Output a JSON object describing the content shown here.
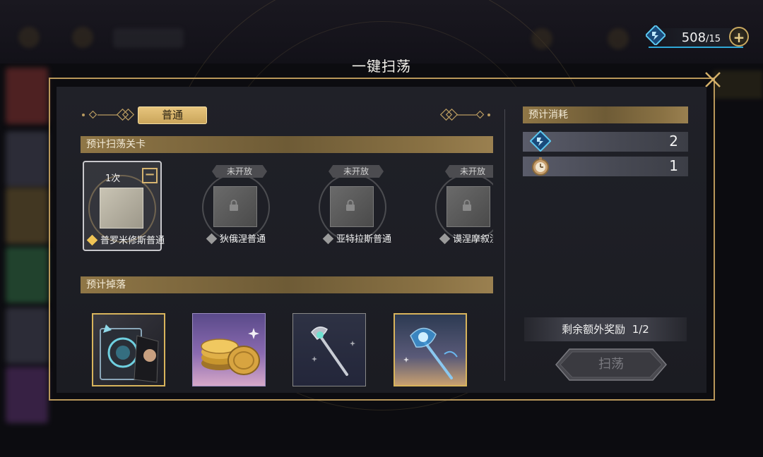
{
  "currency": {
    "amount": "508",
    "max": "/15",
    "icon": "energy-icon",
    "add_icon": "plus-icon"
  },
  "modal": {
    "title": "一键扫荡",
    "close_icon": "close-icon"
  },
  "difficulty": {
    "selected": "普通"
  },
  "stages_header": "预计扫荡关卡",
  "stages": [
    {
      "name": "普罗米修斯普通",
      "count": "1次",
      "locked": false,
      "selected": true
    },
    {
      "name": "狄俄涅普通",
      "status": "未开放",
      "locked": true
    },
    {
      "name": "亚特拉斯普通",
      "status": "未开放",
      "locked": true
    },
    {
      "name": "谟涅摩叙涅",
      "status": "未开放",
      "locked": true
    }
  ],
  "drops_header": "预计掉落",
  "drops": [
    {
      "icon": "tarot-card-icon",
      "rarity": "gold"
    },
    {
      "icon": "gold-coins-icon",
      "rarity": "purple"
    },
    {
      "icon": "silver-staff-icon",
      "rarity": "silver"
    },
    {
      "icon": "crystal-wand-icon",
      "rarity": "gold"
    }
  ],
  "cost": {
    "header": "预计消耗",
    "items": [
      {
        "icon": "energy-icon",
        "value": "2"
      },
      {
        "icon": "pocket-watch-icon",
        "value": "1"
      }
    ]
  },
  "extra_reward": {
    "label": "剩余额外奖励",
    "value": "1/2"
  },
  "sweep_button": {
    "label": "扫荡"
  },
  "colors": {
    "gold": "#c9a45a",
    "energy_blue": "#2fa8d8",
    "panel": "#1e1f25"
  }
}
